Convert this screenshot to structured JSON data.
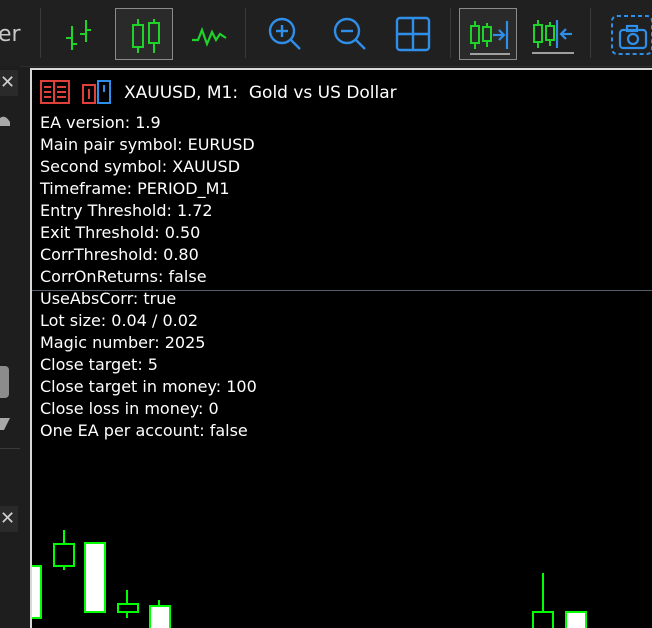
{
  "toolbar": {
    "cut_label": "er",
    "buttons": [
      {
        "name": "bar-chart-icon",
        "active": false
      },
      {
        "name": "candlestick-chart-icon",
        "active": true
      },
      {
        "name": "line-chart-icon",
        "active": false
      },
      {
        "name": "zoom-in-icon",
        "active": false
      },
      {
        "name": "zoom-out-icon",
        "active": false
      },
      {
        "name": "tile-windows-icon",
        "active": false
      },
      {
        "name": "auto-scroll-icon",
        "active": true
      },
      {
        "name": "chart-shift-icon",
        "active": false
      },
      {
        "name": "screenshot-icon",
        "active": false
      }
    ],
    "colors": {
      "green": "#1fd32a",
      "blue": "#2f8fe8"
    }
  },
  "side": {
    "close_glyph": "✕"
  },
  "chart": {
    "title": "XAUUSD, M1:  Gold vs US Dollar",
    "info_lines": [
      "EA version: 1.9",
      "Main pair symbol: EURUSD",
      "Second symbol: XAUUSD",
      "Timeframe: PERIOD_M1",
      "Entry Threshold: 1.72",
      "Exit Threshold: 0.50",
      "CorrThreshold: 0.80",
      "CorrOnReturns: false",
      "UseAbsCorr: true",
      "Lot size: 0.04 / 0.02",
      "Magic number: 2025",
      "Close target: 5",
      "Close target in money: 100",
      "Close loss in money: 0",
      "One EA per account: false"
    ],
    "colors": {
      "background": "#000000",
      "bull": "#00ff00",
      "bear_body": "#ffffff"
    }
  }
}
